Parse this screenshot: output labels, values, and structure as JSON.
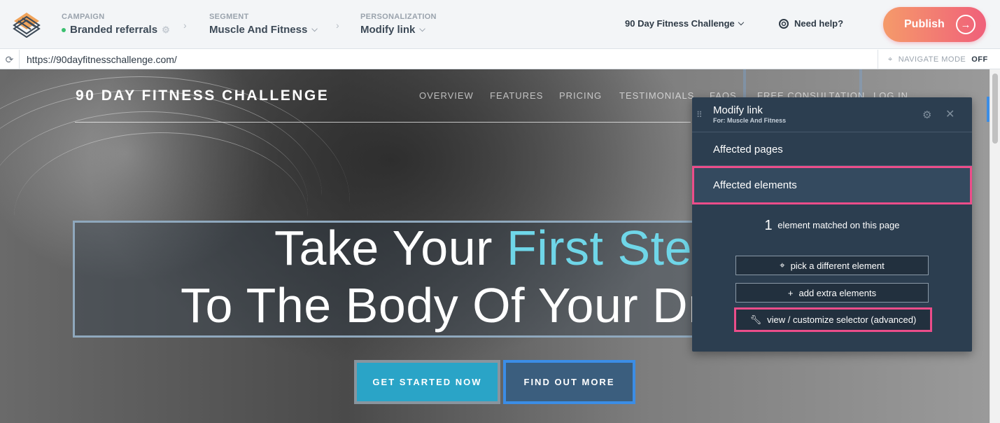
{
  "topbar": {
    "campaign_label": "CAMPAIGN",
    "campaign_value": "Branded referrals",
    "segment_label": "SEGMENT",
    "segment_value": "Muscle And Fitness",
    "personalization_label": "PERSONALIZATION",
    "personalization_value": "Modify link",
    "project_name": "90 Day Fitness Challenge",
    "help_label": "Need help?",
    "publish_label": "Publish",
    "campaign_status_color": "#3bbf6f",
    "publish_gradient": [
      "#f59a6a",
      "#f0607a"
    ]
  },
  "urlbar": {
    "url": "https://90dayfitnesschallenge.com/",
    "navigate_mode_label": "NAVIGATE MODE",
    "navigate_mode_state": "OFF"
  },
  "site": {
    "brand": "90 DAY FITNESS CHALLENGE",
    "nav": [
      "OVERVIEW",
      "FEATURES",
      "PRICING",
      "TESTIMONIALS",
      "FAQS",
      "FREE CONSULTATION",
      "LOG IN"
    ],
    "headline_part1": "Take Your ",
    "headline_accent": "First Step",
    "headline_line2": "To The Body Of Your Dreams",
    "accent_color": "#6fd6e8",
    "cta_primary": "GET STARTED NOW",
    "cta_secondary": "FIND OUT MORE"
  },
  "panel": {
    "title": "Modify link",
    "subtitle": "For: Muscle And Fitness",
    "affected_pages": "Affected pages",
    "affected_elements": "Affected elements",
    "matched_count": "1",
    "matched_text": "element matched on this page",
    "pick_button": "pick a different element",
    "add_button": "add extra elements",
    "selector_button": "view / customize selector (advanced)",
    "highlight_color": "#ec4d8a"
  },
  "icons": [
    "logo-icon",
    "gear-icon",
    "chevron-down-icon",
    "lifebuoy-icon",
    "arrow-right-icon",
    "refresh-icon",
    "crosshair-icon",
    "drag-handle-icon",
    "close-icon",
    "plus-icon",
    "wrench-icon"
  ]
}
